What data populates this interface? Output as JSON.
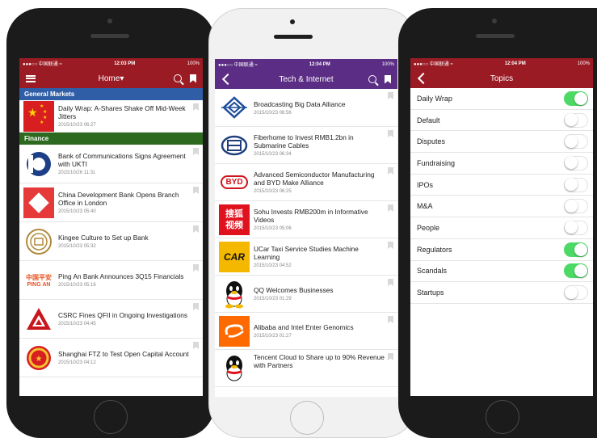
{
  "status_bar": {
    "carrier_1": "●●●○○ 中国联通 ≈",
    "time_1": "12:03 PM",
    "battery_1": "100%",
    "carrier_2": "●●●○○ 中国联通 ≈",
    "time_2": "12:04 PM",
    "battery_2": "100%",
    "carrier_3": "●●●○○ 中国联通 ≈",
    "time_3": "12:04 PM",
    "battery_3": "100%"
  },
  "screen1": {
    "title": "Home▾",
    "sections": [
      {
        "label": "General Markets",
        "items": [
          {
            "title": "Daily Wrap: A-Shares Shake Off Mid-Week Jitters",
            "date": "2015/10/23 06:27"
          }
        ]
      },
      {
        "label": "Finance",
        "items": [
          {
            "title": "Bank of Communications Signs Agreement with UKTI",
            "date": "2015/10/26 11:31"
          },
          {
            "title": "China Development Bank Opens Branch Office in London",
            "date": "2015/10/23 05:40"
          },
          {
            "title": "Kingee Culture to Set up Bank",
            "date": "2015/10/23 05:32"
          },
          {
            "title": "Ping An Bank Announces 3Q15 Financials",
            "date": "2015/10/23 05:16"
          },
          {
            "title": "CSRC Fines QFII in Ongoing Investigations",
            "date": "2015/10/23 04:45"
          },
          {
            "title": "Shanghai FTZ to Test Open Capital Account",
            "date": "2015/10/23 04:12"
          }
        ]
      }
    ],
    "logo_text": {
      "pingan_cn": "中国平安",
      "pingan_en": "PING AN"
    }
  },
  "screen2": {
    "title": "Tech & Internet",
    "items": [
      {
        "title": "Broadcasting Big Data Alliance",
        "date": "2015/10/23 06:56"
      },
      {
        "title": "Fiberhome to Invest RMB1.2bn in Submarine Cables",
        "date": "2015/10/23 06:34"
      },
      {
        "title": "Advanced Semiconductor Manufacturing and BYD Make Alliance",
        "date": "2015/10/23 06:25"
      },
      {
        "title": "Sohu Invests RMB200m in Informative Videos",
        "date": "2015/10/23 05:06"
      },
      {
        "title": "UCar Taxi Service Studies Machine Learning",
        "date": "2015/10/23 04:52"
      },
      {
        "title": "QQ Welcomes Businesses",
        "date": "2015/10/23 01:29"
      },
      {
        "title": "Alibaba and Intel Enter Genomics",
        "date": "2015/10/23 01:27"
      },
      {
        "title": "Tencent Cloud to Share up to 90% Revenue with Partners",
        "date": ""
      }
    ],
    "logo_text": {
      "byd": "BYD",
      "sohu": "搜狐视频",
      "car": "CAR"
    }
  },
  "screen3": {
    "title": "Topics",
    "topics": [
      {
        "label": "Daily Wrap",
        "enabled": true
      },
      {
        "label": "Default",
        "enabled": false
      },
      {
        "label": "Disputes",
        "enabled": false
      },
      {
        "label": "Fundraising",
        "enabled": false
      },
      {
        "label": "IPOs",
        "enabled": false
      },
      {
        "label": "M&A",
        "enabled": false
      },
      {
        "label": "People",
        "enabled": false
      },
      {
        "label": "Regulators",
        "enabled": true
      },
      {
        "label": "Scandals",
        "enabled": true
      },
      {
        "label": "Startups",
        "enabled": false
      }
    ]
  },
  "colors": {
    "maroon": "#9a1b24",
    "purple": "#5b2d84",
    "section_blue": "#2f5ea7",
    "section_green": "#2d6a1f",
    "toggle_on": "#4cd964"
  }
}
